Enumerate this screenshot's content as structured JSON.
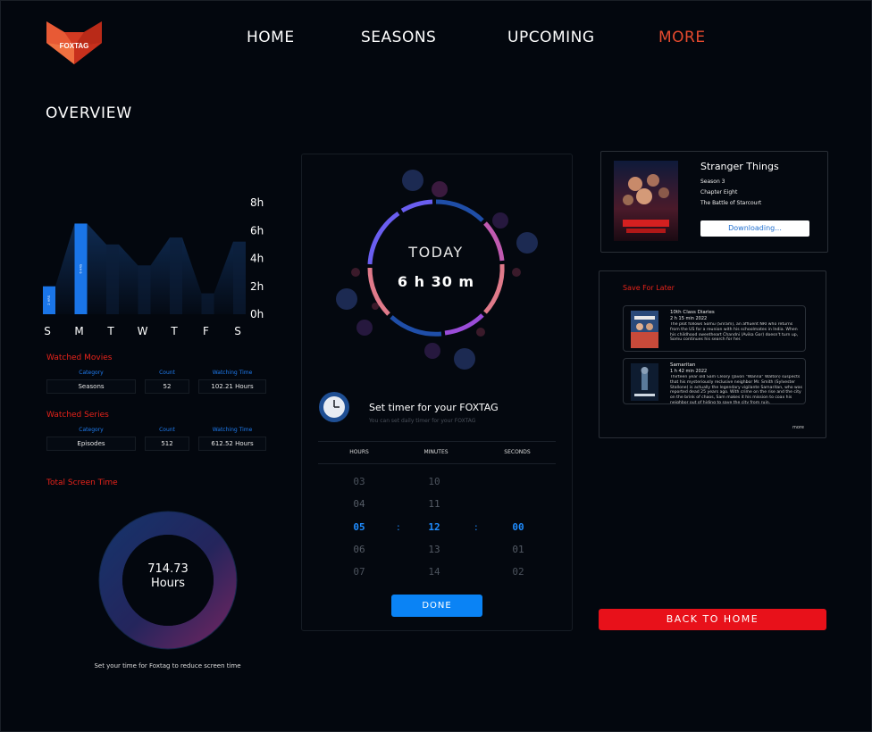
{
  "brand": {
    "logo_text": "FOXTAG",
    "accent_color": "#e64a2e"
  },
  "nav": [
    {
      "label": "HOME",
      "active": false
    },
    {
      "label": "SEASONS",
      "active": false
    },
    {
      "label": "UPCOMING",
      "active": false
    },
    {
      "label": "MORE",
      "active": true
    }
  ],
  "overview": {
    "title": "OVERVIEW",
    "chart_data": {
      "type": "bar",
      "categories": [
        "S",
        "M",
        "T",
        "W",
        "T",
        "F",
        "S"
      ],
      "values": [
        2,
        6.5,
        5,
        3.5,
        5.5,
        1.5,
        5.2
      ],
      "highlighted": [
        true,
        true,
        false,
        false,
        false,
        false,
        false
      ],
      "bar_labels": [
        "2 HRS",
        "6 HRS",
        "",
        "",
        "",
        "",
        ""
      ],
      "ytick_labels": [
        "8h",
        "6h",
        "4h",
        "2h",
        "0h"
      ],
      "ylim": [
        0,
        8
      ],
      "bar_color": "#1a75e8",
      "area_color": "#0b1e38"
    }
  },
  "watched_movies": {
    "title": "Watched Movies",
    "headers": [
      "Category",
      "Count",
      "Watching Time"
    ],
    "row": [
      "Seasons",
      "52",
      "102.21 Hours"
    ]
  },
  "watched_series": {
    "title": "Watched Series",
    "headers": [
      "Category",
      "Count",
      "Watching Time"
    ],
    "row": [
      "Episodes",
      "512",
      "612.52 Hours"
    ]
  },
  "screen_time": {
    "title": "Total Screen Time",
    "value": "714.73",
    "unit": "Hours",
    "note": "Set your time for Foxtag to reduce screen time"
  },
  "today": {
    "label": "TODAY",
    "time": "6 h 30 m"
  },
  "timer": {
    "title": "Set timer for your FOXTAG",
    "subtitle": "You can set daily timer for your FOXTAG",
    "headers": [
      "HOURS",
      "MINUTES",
      "SECONDS"
    ],
    "hours": [
      "03",
      "04",
      "05",
      "06",
      "07"
    ],
    "minutes": [
      "10",
      "11",
      "12",
      "13",
      "14"
    ],
    "seconds": [
      "",
      "",
      "00",
      "01",
      "02"
    ],
    "done_label": "DONE"
  },
  "now_downloading": {
    "title": "Stranger Things",
    "season": "Season 3",
    "chapter": "Chapter Eight",
    "episode": "The Battle of Starcourt",
    "button": "Downloading..."
  },
  "save_for_later": {
    "title": "Save For Later",
    "items": [
      {
        "title": "10th Class Diaries",
        "meta": "2 h 15 min 2022",
        "desc": "The plot follows Somu (Sriram), an affluent NRI who returns from the US for a reunion with his schoolmates in India. When his childhood sweetheart Chandni (Avika Gor) doesn't turn up, Somu continues his search for her."
      },
      {
        "title": "Samaritan",
        "meta": "1 h 42 min 2022",
        "desc": "Thirteen year old Sam Cleary (Javon \"Wanna\" Walton) suspects that his mysteriously reclusive neighbor Mr. Smith (Sylvester Stallone) is actually the legendary vigilante Samaritan, who was reported dead 25 years ago. With crime on the rise and the city on the brink of chaos, Sam makes it his mission to coax his neighbor out of hiding to save the city from ruin."
      }
    ],
    "more_label": "more"
  },
  "back_button": "BACK TO HOME"
}
